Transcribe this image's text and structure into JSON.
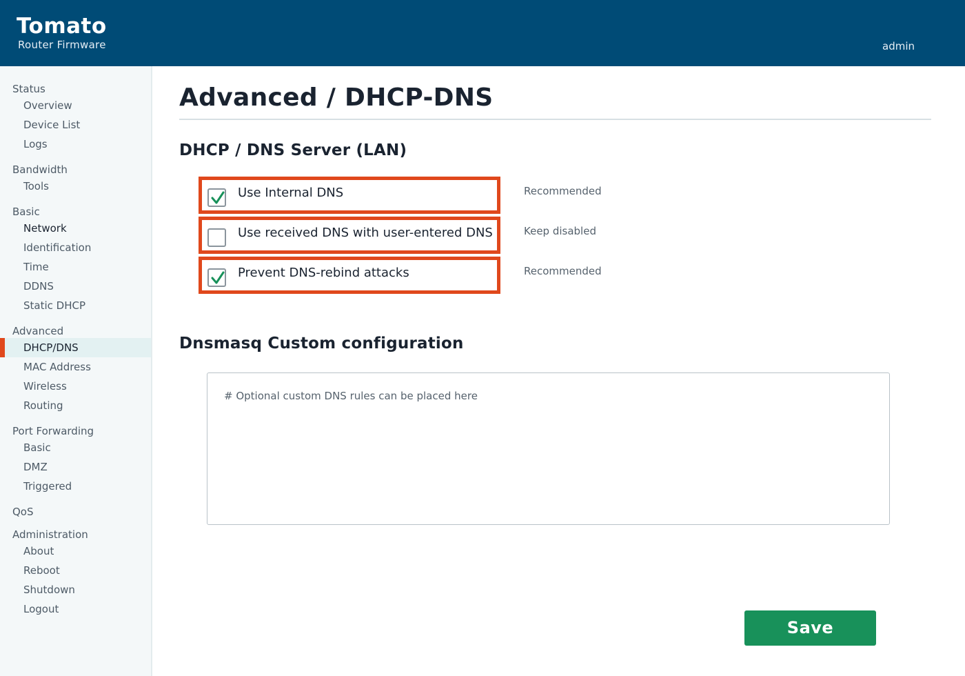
{
  "header": {
    "title": "Tomato",
    "subtitle": "Router Firmware",
    "user": "admin"
  },
  "sidebar": {
    "groups": [
      {
        "label": "Status",
        "items": [
          "Overview",
          "Device List",
          "Logs"
        ]
      },
      {
        "label": "Bandwidth",
        "items": [
          "Tools"
        ]
      },
      {
        "label": "Basic",
        "items": [
          "Network",
          "Identification",
          "Time",
          "DDNS",
          "Static DHCP"
        ]
      },
      {
        "label": "Advanced",
        "items": [
          "DHCP/DNS",
          "MAC Address",
          "Wireless",
          "Routing"
        ]
      },
      {
        "label": "Port Forwarding",
        "items": [
          "Basic",
          "DMZ",
          "Triggered"
        ]
      },
      {
        "label": "QoS",
        "items": []
      },
      {
        "label": "Administration",
        "items": [
          "About",
          "Reboot",
          "Shutdown",
          "Logout"
        ]
      }
    ],
    "active_item": "DHCP/DNS"
  },
  "main": {
    "page_title": "Advanced / DHCP-DNS",
    "dns_section": {
      "title": "DHCP / DNS Server (LAN)",
      "options": [
        {
          "label": "Use Internal DNS",
          "checked": true,
          "hint": "Recommended"
        },
        {
          "label": "Use received DNS with user-entered DNS",
          "checked": false,
          "hint": "Keep disabled"
        },
        {
          "label": "Prevent DNS-rebind attacks",
          "checked": true,
          "hint": "Recommended"
        }
      ]
    },
    "custom_section": {
      "title": "Dnsmasq Custom configuration",
      "placeholder": "# Optional custom DNS rules can be placed here"
    },
    "save_label": "Save"
  },
  "colors": {
    "header_bg": "#004b76",
    "accent": "#e0481c",
    "save_bg": "#18915a",
    "check": "#18915a"
  }
}
